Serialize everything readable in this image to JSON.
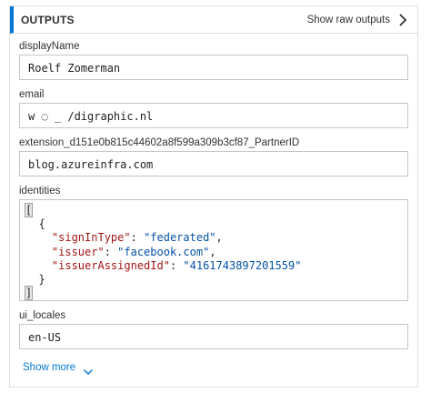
{
  "header": {
    "title": "OUTPUTS",
    "raw_outputs_label": "Show raw outputs"
  },
  "fields": {
    "displayName": {
      "label": "displayName",
      "value": "Roelf Zomerman"
    },
    "email": {
      "label": "email",
      "value": "w     ◌  ̲ /digraphic.nl"
    },
    "extension": {
      "label": "extension_d151e0b815c44602a8f599a309b3cf87_PartnerID",
      "value": "blog.azureinfra.com"
    },
    "identities": {
      "label": "identities",
      "open_bracket": "[",
      "open_brace": "{",
      "entries": [
        {
          "key": "\"signInType\"",
          "sep": ": ",
          "value": "\"federated\"",
          "trail": ","
        },
        {
          "key": "\"issuer\"",
          "sep": ": ",
          "value": "\"facebook.com\"",
          "trail": ","
        },
        {
          "key": "\"issuerAssignedId\"",
          "sep": ": ",
          "value": "\"4161743897201559\"",
          "trail": ""
        }
      ],
      "close_brace": "}",
      "close_bracket": "]"
    },
    "ui_locales": {
      "label": "ui_locales",
      "value": "en-US"
    }
  },
  "show_more_label": "Show more",
  "icons": {
    "raw_outputs": "chevron-right-icon",
    "show_more": "chevron-down-icon"
  },
  "colors": {
    "accent": "#0078d4",
    "json_key": "#a31515",
    "json_string": "#0451a5"
  }
}
